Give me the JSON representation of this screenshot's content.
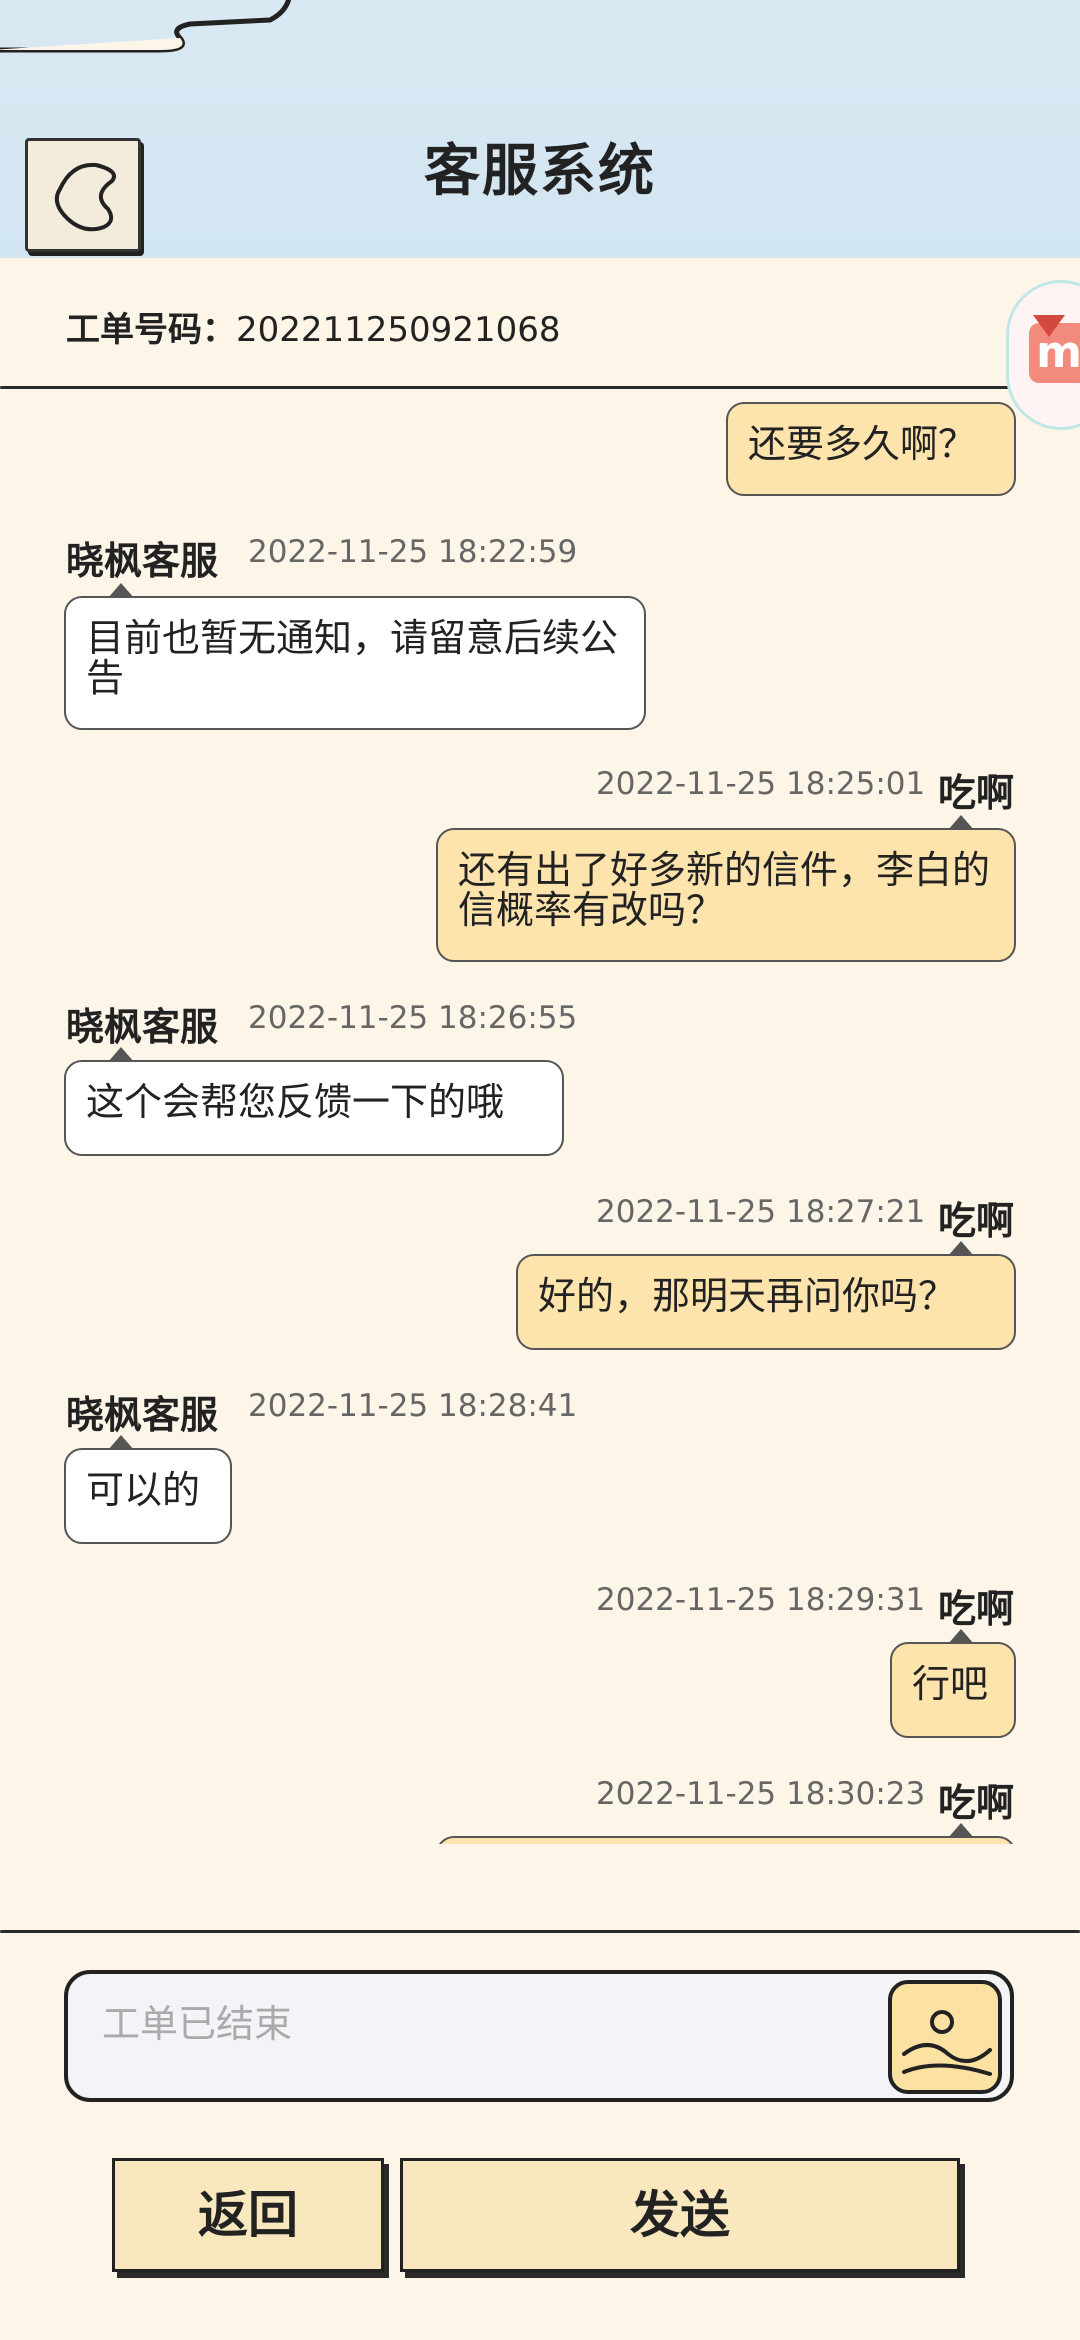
{
  "header": {
    "title": "客服系统"
  },
  "ticket": {
    "label": "工单号码：",
    "number": "202211250921068"
  },
  "messages": [
    {
      "side": "right",
      "text": "还要多久啊？"
    },
    {
      "side": "left",
      "sender": "晓枫客服",
      "time": "2022-11-25 18:22:59",
      "text": "目前也暂无通知，请留意后续公告"
    },
    {
      "side": "right",
      "sender": "吃啊",
      "time": "2022-11-25 18:25:01",
      "text": "还有出了好多新的信件，李白的信概率有改吗？"
    },
    {
      "side": "left",
      "sender": "晓枫客服",
      "time": "2022-11-25 18:26:55",
      "text": "这个会帮您反馈一下的哦"
    },
    {
      "side": "right",
      "sender": "吃啊",
      "time": "2022-11-25 18:27:21",
      "text": "好的，那明天再问你吗？"
    },
    {
      "side": "left",
      "sender": "晓枫客服",
      "time": "2022-11-25 18:28:41",
      "text": "可以的"
    },
    {
      "side": "right",
      "sender": "吃啊",
      "time": "2022-11-25 18:29:31",
      "text": "行吧"
    },
    {
      "side": "right",
      "sender": "吃啊",
      "time": "2022-11-25 18:30:23",
      "text": ""
    }
  ],
  "input": {
    "placeholder": "工单已结束"
  },
  "buttons": {
    "back": "返回",
    "send": "发送"
  },
  "icons": {
    "back": "back-arrow-icon",
    "image": "image-upload-icon",
    "floating": "floating-app-icon"
  }
}
